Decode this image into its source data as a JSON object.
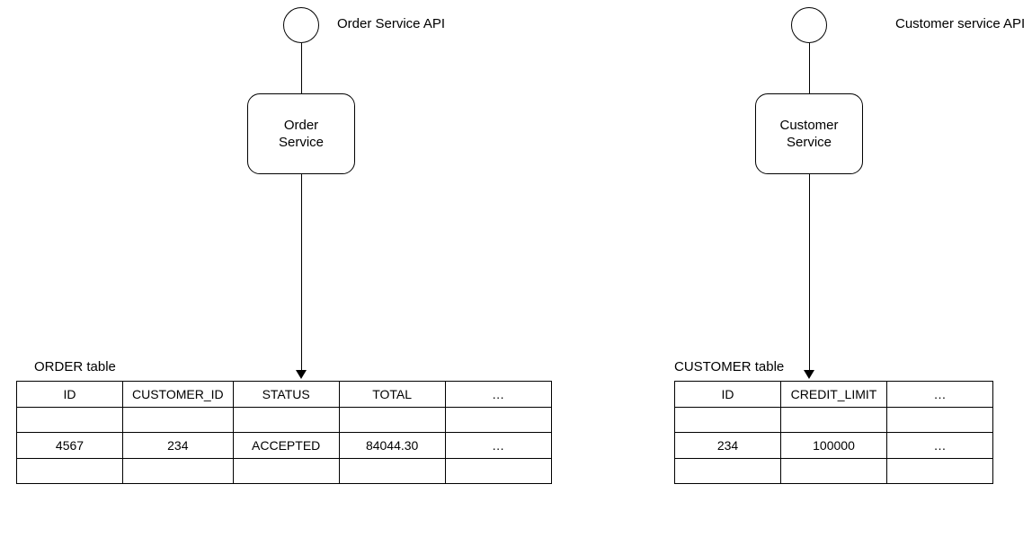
{
  "left": {
    "api_label": "Order Service API",
    "service_label": "Order\nService",
    "table_title": "ORDER table",
    "headers": [
      "ID",
      "CUSTOMER_ID",
      "STATUS",
      "TOTAL",
      "…"
    ],
    "row": [
      "4567",
      "234",
      "ACCEPTED",
      "84044.30",
      "…"
    ]
  },
  "right": {
    "api_label": "Customer service API",
    "service_label": "Customer\nService",
    "table_title": "CUSTOMER table",
    "headers": [
      "ID",
      "CREDIT_LIMIT",
      "…"
    ],
    "row": [
      "234",
      "100000",
      "…"
    ]
  }
}
